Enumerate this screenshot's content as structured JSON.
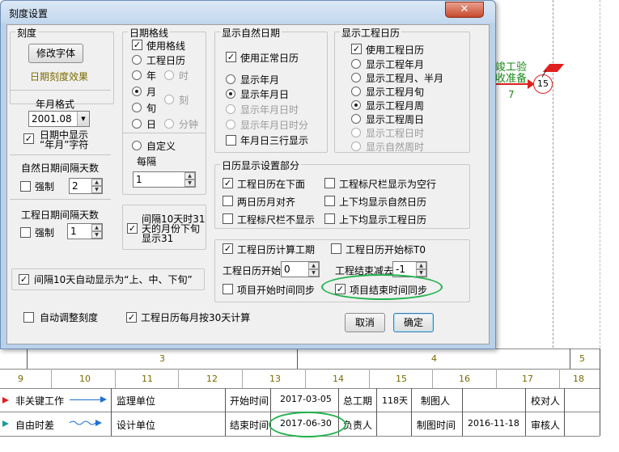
{
  "window": {
    "title": "刻度设置",
    "close_glyph": "✕"
  },
  "scale_group": {
    "title": "刻度",
    "change_font_button": "修改字体",
    "date_scale_effect": "日期刻度效果",
    "year_month_format_label": "年月格式",
    "year_month_format_value": "2001.08",
    "show_year_month_in_date": "日期中显示\n“年月”字符",
    "natural_interval_label": "自然日期间隔天数",
    "natural_force_label": "强制",
    "natural_interval_value": "2",
    "work_interval_label": "工程日期间隔天数",
    "work_force_label": "强制",
    "work_interval_value": "1",
    "auto_ten_day_label": "间隔10天自动显示为“上、中、下旬”",
    "auto_adjust_label": "自动调整刻度"
  },
  "gridline_group": {
    "title": "日期格线",
    "use_gridline": "使用格线",
    "options": [
      "工程日历",
      "年",
      "时",
      "月",
      "刻",
      "旬",
      "日",
      "分钟",
      "自定义"
    ],
    "interval_label": "每隔",
    "interval_value": "1",
    "month31_label": "间隔10天时31\n天的月份下旬\n显示31"
  },
  "natural_date_group": {
    "title": "显示自然日期",
    "use_normal_calendar": "使用正常日历",
    "options": [
      "显示年月",
      "显示年月日",
      "显示年月日时",
      "显示年月日时分",
      "年月日三行显示"
    ]
  },
  "work_calendar_group": {
    "title": "显示工程日历",
    "use_work_calendar": "使用工程日历",
    "options": [
      "显示工程年月",
      "显示工程月、半月",
      "显示工程月旬",
      "显示工程月周",
      "显示工程周日",
      "显示工程日时",
      "显示自然周时"
    ]
  },
  "calendar_display_group": {
    "title": "日历显示设置部分",
    "items": [
      "工程日历在下面",
      "工程标尺栏显示为空行",
      "两日历月对齐",
      "上下均显示自然日历",
      "工程标尺栏不显示",
      "上下均显示工程日历"
    ]
  },
  "work_period_group": {
    "calc_period": "工程日历计算工期",
    "start_t0": "工程日历开始标T0",
    "start_label": "工程日历开始",
    "start_value": "0",
    "end_minus_label": "工程结束减去",
    "end_minus_value": "-1",
    "project_start_sync": "项目开始时间同步",
    "project_end_sync": "项目结束时间同步"
  },
  "month30_label": "工程日历每月按30天计算",
  "buttons": {
    "cancel": "取消",
    "ok": "确定"
  },
  "background": {
    "node_label_top": "竣工验",
    "node_label_bottom": "收准备",
    "node_number": "15",
    "node_duration": "7",
    "month_row": [
      "3",
      "4",
      "5"
    ],
    "day_row": [
      "9",
      "10",
      "11",
      "12",
      "13",
      "14",
      "15",
      "16",
      "17",
      "18"
    ],
    "legend": [
      {
        "name": "非关键工作"
      },
      {
        "name": "自由时差"
      }
    ],
    "info_row1": [
      "监理单位",
      "开始时间",
      "2017-03-05",
      "总工期",
      "118天",
      "制图人",
      "校对人"
    ],
    "info_row2": [
      "设计单位",
      "结束时间",
      "2017-06-30",
      "负责人",
      "制图时间",
      "2016-11-18",
      "审核人"
    ]
  }
}
